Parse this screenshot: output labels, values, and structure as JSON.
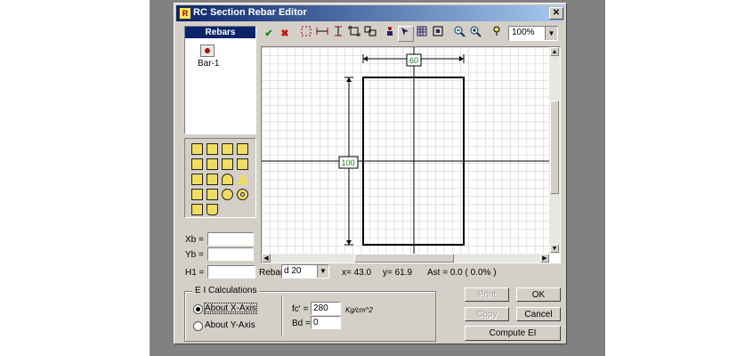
{
  "window": {
    "title": "RC Section Rebar Editor",
    "close_glyph": "✕",
    "icon_glyph": "R"
  },
  "rebars": {
    "header": "Rebars",
    "items": [
      {
        "label": "Bar-1"
      }
    ]
  },
  "toolbar": {
    "zoom": "100%"
  },
  "canvas": {
    "width_dim": "60",
    "height_dim": "100"
  },
  "fields": {
    "xb_label": "Xb =",
    "yb_label": "Yb =",
    "h1_label": "H1 =",
    "rebar_label": "Rebar:",
    "rebar_value": "d 20"
  },
  "status": {
    "x": "x= 43.0",
    "y": "y= 61.9",
    "ast": "Ast = 0.0  ( 0.0% )"
  },
  "ei": {
    "legend": "E I  Calculations",
    "about_x": "About X-Axis",
    "about_y": "About Y-Axis",
    "fc_label": "fc' =",
    "fc_value": "280",
    "fc_unit": "Kg/cm^2",
    "bd_label": "Bd =",
    "bd_value": "0"
  },
  "buttons": {
    "print": "Print",
    "ok": "OK",
    "copy": "Copy",
    "cancel": "Cancel",
    "compute": "Compute EI"
  }
}
